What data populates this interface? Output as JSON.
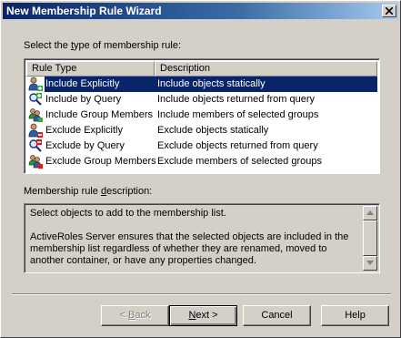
{
  "window": {
    "title": "New Membership Rule Wizard"
  },
  "prompt": {
    "pre": "Select the ",
    "accel": "t",
    "post": "ype of membership rule:"
  },
  "list": {
    "columns": [
      "Rule Type",
      "Description"
    ],
    "rows": [
      {
        "name": "Include Explicitly",
        "desc": "Include objects statically",
        "icon": "include-explicitly-icon",
        "selected": true
      },
      {
        "name": "Include by Query",
        "desc": "Include objects returned from query",
        "icon": "include-query-icon"
      },
      {
        "name": "Include Group Members",
        "desc": "Include members of selected groups",
        "icon": "include-group-icon"
      },
      {
        "name": "Exclude Explicitly",
        "desc": "Exclude objects statically",
        "icon": "exclude-explicitly-icon"
      },
      {
        "name": "Exclude by Query",
        "desc": "Exclude objects returned from query",
        "icon": "exclude-query-icon"
      },
      {
        "name": "Exclude Group Members",
        "desc": "Exclude members of selected groups",
        "icon": "exclude-group-icon"
      }
    ]
  },
  "description": {
    "label_pre": "Membership rule ",
    "label_accel": "d",
    "label_post": "escription:",
    "text": "Select objects to add to the membership list.\n\nActiveRoles Server ensures that the selected objects are included in the membership list regardless of whether they are renamed, moved to another container, or have any properties changed."
  },
  "buttons": {
    "back_accel": "B",
    "back_pre": "< ",
    "back_post": "ack",
    "next_accel": "N",
    "next_post": "ext >",
    "cancel": "Cancel",
    "help": "Help"
  }
}
